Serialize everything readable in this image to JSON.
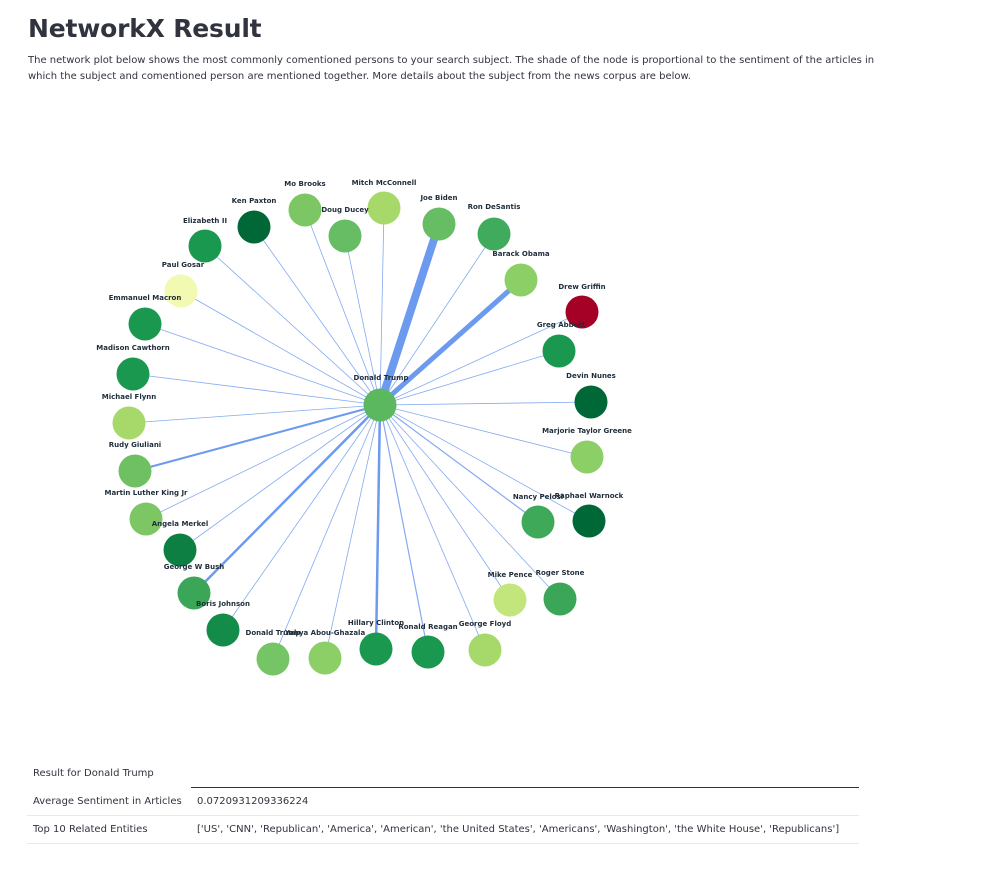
{
  "title": "NetworkX Result",
  "description": "The network plot below shows the most commonly comentioned persons to your search subject. The shade of the node is proportional to the sentiment of the articles in which the subject and comentioned person are mentioned together. More details about the subject from the news corpus are below.",
  "graph": {
    "center": {
      "label": "Donald Trump",
      "color": "#5cb85f"
    },
    "nodes": [
      {
        "label": "Joe Biden",
        "color": "#66bd63",
        "weight": 8
      },
      {
        "label": "Ron DeSantis",
        "color": "#41ab5d",
        "weight": 0.8
      },
      {
        "label": "Barack Obama",
        "color": "#8bcf66",
        "weight": 5
      },
      {
        "label": "Drew Griffin",
        "color": "#a50026",
        "weight": 0.8
      },
      {
        "label": "Greg Abbott",
        "color": "#1a9850",
        "weight": 0.8
      },
      {
        "label": "Devin Nunes",
        "color": "#006837",
        "weight": 0.8
      },
      {
        "label": "Marjorie Taylor Greene",
        "color": "#8ccf66",
        "weight": 0.8
      },
      {
        "label": "Raphael Warnock",
        "color": "#006837",
        "weight": 0.8
      },
      {
        "label": "Nancy Pelosi",
        "color": "#3fa95a",
        "weight": 1.2
      },
      {
        "label": "Roger Stone",
        "color": "#3ca658",
        "weight": 0.8
      },
      {
        "label": "Mike Pence",
        "color": "#c2e57c",
        "weight": 0.8
      },
      {
        "label": "George Floyd",
        "color": "#a6d96a",
        "weight": 0.8
      },
      {
        "label": "Ronald Reagan",
        "color": "#1a9850",
        "weight": 1.2
      },
      {
        "label": "Hillary Clinton",
        "color": "#1a9850",
        "weight": 2.5
      },
      {
        "label": "Yahya Abou-Ghazala",
        "color": "#8ccf66",
        "weight": 0.8
      },
      {
        "label": "Donald Trump",
        "color": "#75c465",
        "weight": 0.8
      },
      {
        "label": "Boris Johnson",
        "color": "#138c4a",
        "weight": 0.8
      },
      {
        "label": "George W Bush",
        "color": "#3ca658",
        "weight": 2.5
      },
      {
        "label": "Angela Merkel",
        "color": "#0e7f42",
        "weight": 0.8
      },
      {
        "label": "Martin Luther King Jr",
        "color": "#7cc764",
        "weight": 0.8
      },
      {
        "label": "Rudy Giuliani",
        "color": "#6fc063",
        "weight": 2.0
      },
      {
        "label": "Michael Flynn",
        "color": "#a6d96a",
        "weight": 0.8
      },
      {
        "label": "Madison Cawthorn",
        "color": "#1a9850",
        "weight": 0.8
      },
      {
        "label": "Emmanuel Macron",
        "color": "#1a9850",
        "weight": 0.8
      },
      {
        "label": "Paul Gosar",
        "color": "#f1fab0",
        "weight": 0.8
      },
      {
        "label": "Elizabeth II",
        "color": "#1a9850",
        "weight": 0.8
      },
      {
        "label": "Ken Paxton",
        "color": "#006837",
        "weight": 0.8
      },
      {
        "label": "Mo Brooks",
        "color": "#7cc764",
        "weight": 0.8
      },
      {
        "label": "Doug Ducey",
        "color": "#66bd63",
        "weight": 0.8
      },
      {
        "label": "Mitch McConnell",
        "color": "#a6d96a",
        "weight": 0.8
      }
    ],
    "edge_color": "#6495ed"
  },
  "table": {
    "header_key": "Result for Donald Trump",
    "rows": [
      {
        "key": "Average Sentiment in Articles",
        "value": "0.0720931209336224"
      },
      {
        "key": "Top 10 Related Entities",
        "value": "['US', 'CNN', 'Republican', 'America', 'American', 'the United States', 'Americans', 'Washington', 'the White House', 'Republicans']"
      }
    ]
  }
}
